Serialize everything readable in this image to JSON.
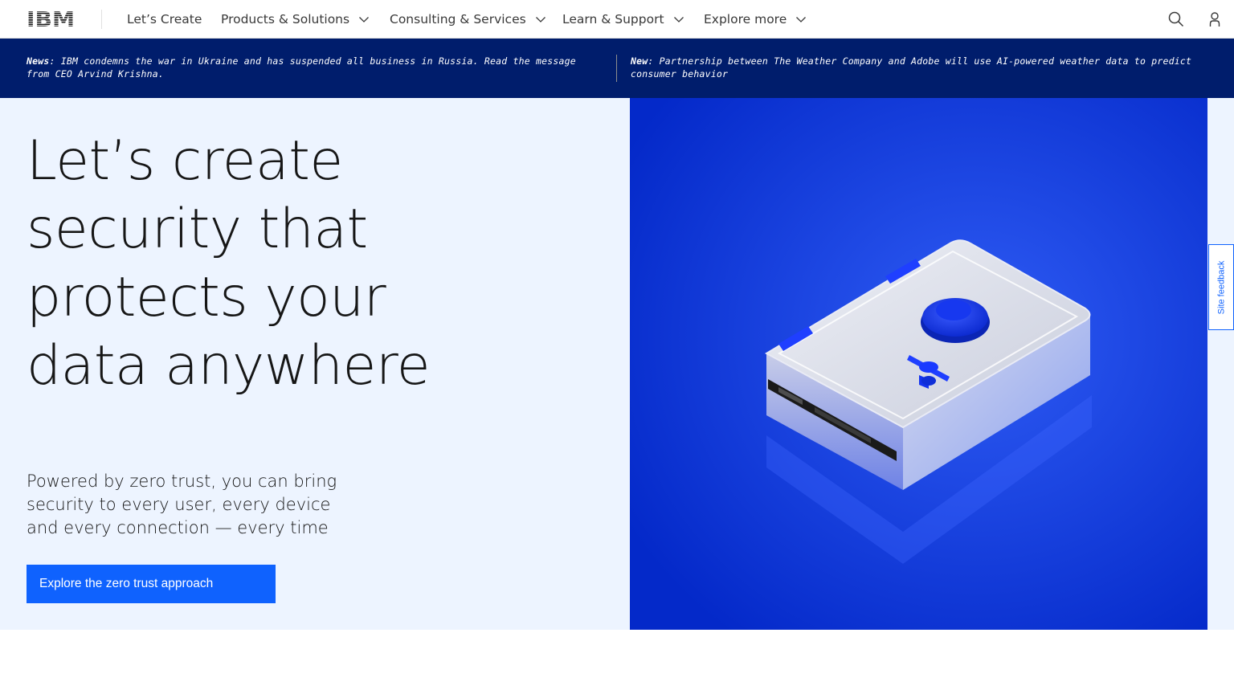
{
  "brand": {
    "logo_text": "IBM"
  },
  "nav": {
    "items": [
      {
        "label": "Let’s Create",
        "has_menu": false
      },
      {
        "label": "Products & Solutions",
        "has_menu": true
      },
      {
        "label": "Consulting & Services",
        "has_menu": true
      },
      {
        "label": "Learn & Support",
        "has_menu": true
      },
      {
        "label": "Explore more",
        "has_menu": true
      }
    ],
    "icons": [
      "search-icon",
      "user-icon"
    ]
  },
  "ribbon": {
    "news": [
      {
        "prefix": "News",
        "text": ": IBM condemns the war in Ukraine and has suspended all business in Russia. Read the message from CEO Arvind Krishna."
      },
      {
        "prefix": "New",
        "text": ": Partnership between The Weather Company and Adobe will use AI-powered weather data to predict consumer behavior"
      }
    ]
  },
  "hero": {
    "title": "Let’s create security that protects your data anywhere",
    "subtitle": "Powered by zero trust, you can bring security to every user, every device and every connection — every time",
    "cta_label": "Explore the zero trust approach",
    "image_icon": "safe-illustration"
  },
  "feedback": {
    "label": "Site feedback"
  },
  "colors": {
    "ribbon_bg": "#001d6c",
    "hero_bg": "#edf4ff",
    "image_bg": "#0530d8",
    "cta_bg": "#0f62fe"
  }
}
